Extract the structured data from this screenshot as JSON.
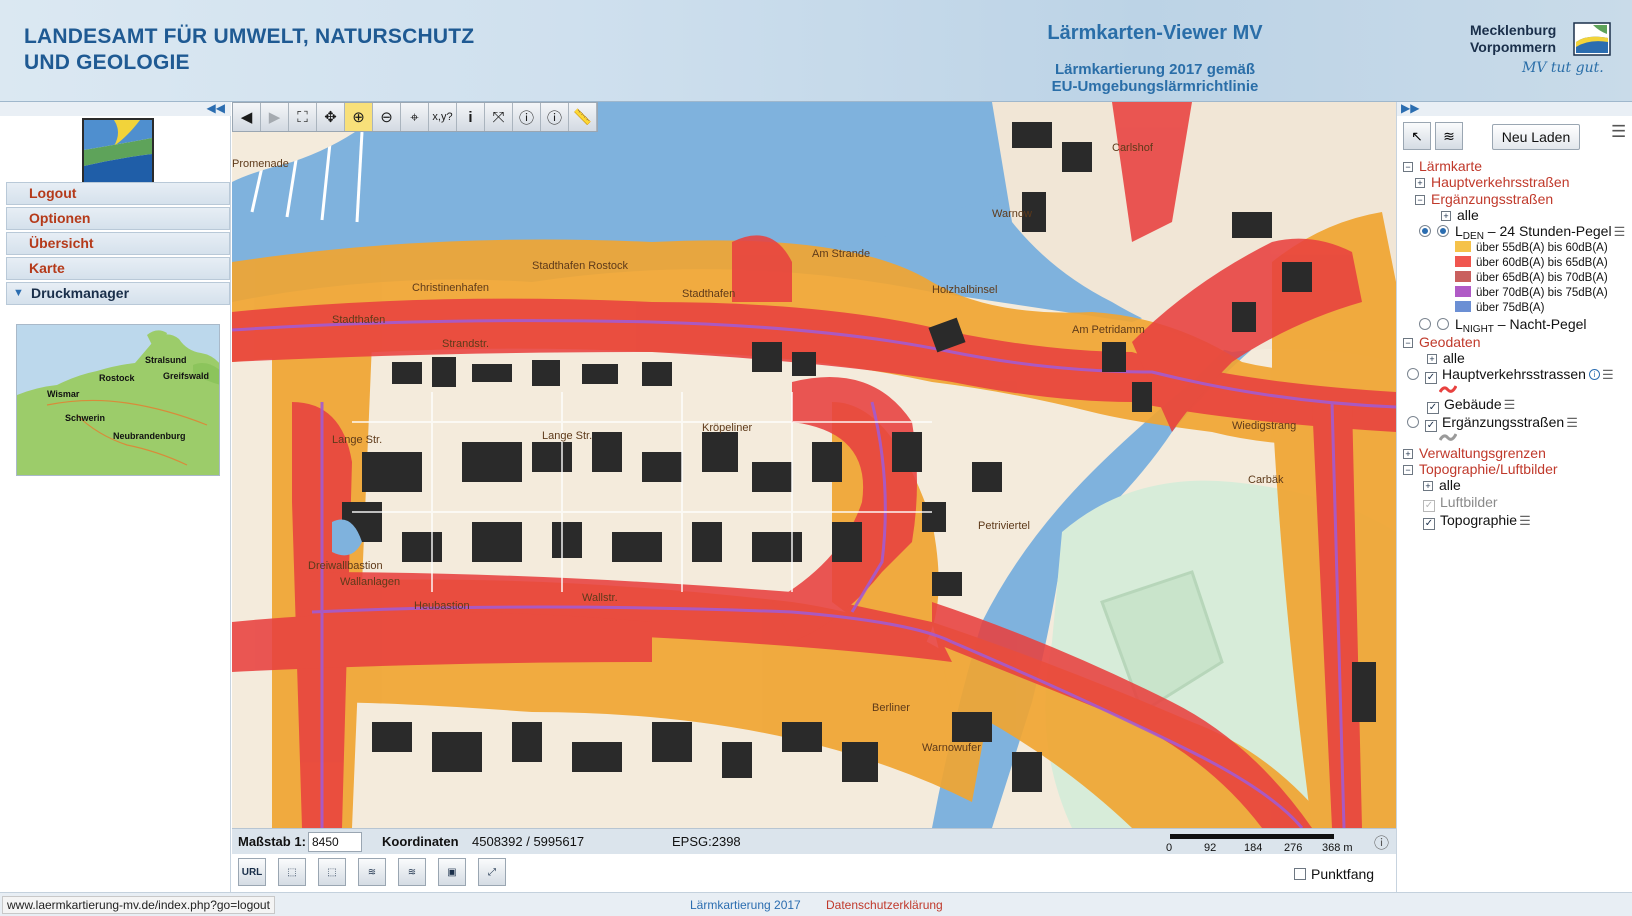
{
  "header": {
    "org_line1": "LANDESAMT FÜR UMWELT, NATURSCHUTZ",
    "org_line2": "UND GEOLOGIE",
    "viewer_title": "Lärmkarten-Viewer MV",
    "viewer_sub1": "Lärmkartierung 2017 gemäß",
    "viewer_sub2": "EU-Umgebungslärmrichtlinie",
    "logo_line1": "Mecklenburg",
    "logo_line2": "Vorpommern",
    "logo_slogan": "MV tut gut."
  },
  "left_menu": {
    "items": [
      "Logout",
      "Optionen",
      "Übersicht",
      "Karte"
    ],
    "active_item": "Druckmanager"
  },
  "overview_map": {
    "cities": [
      "Stralsund",
      "Rostock",
      "Greifswald",
      "Wismar",
      "Schwerin",
      "Neubrandenburg"
    ]
  },
  "map_labels": [
    "Promenade",
    "Stadthafen Rostock",
    "Christinenhafen",
    "Stadthafen",
    "Stadthafen",
    "Strandstr.",
    "Am Strande",
    "Lange Str.",
    "Lange Str.",
    "Wallstr.",
    "Wallanlagen",
    "Dreiwallbastion",
    "Am Petridamm",
    "Holzhalbinsel",
    "Petriviertel",
    "Wiedigstrang",
    "Carbäk",
    "Warnow",
    "Warnowufer",
    "Heubastion",
    "Kröpeliner",
    "Berliner",
    "Carlshof"
  ],
  "toolbar": {
    "tools": [
      "back-icon",
      "forward-icon",
      "zoom-full-icon",
      "pan-icon",
      "zoom-in-icon",
      "zoom-out-icon",
      "recenter-icon",
      "coordinates-icon",
      "info-icon",
      "zoom-extent-icon",
      "query-info-icon",
      "object-info-icon",
      "measure-icon"
    ],
    "coord_label": "x,y?",
    "info_label": "i"
  },
  "legend_panel": {
    "reload_label": "Neu Laden",
    "group_laermkarte": "Lärmkarte",
    "hauptverkehr": "Hauptverkehrsstraßen",
    "ergaenzung": "Ergänzungsstraßen",
    "alle": "alle",
    "lden_prefix": "L",
    "lden_sub": "DEN",
    "lden_suffix": " – 24 Stunden-Pegel",
    "lnight_prefix": "L",
    "lnight_sub": "NIGHT",
    "lnight_suffix": " – Nacht-Pegel",
    "classes": [
      {
        "label": "über 55dB(A) bis 60dB(A)",
        "color": "#f5c24a"
      },
      {
        "label": "über 60dB(A) bis 65dB(A)",
        "color": "#f0564f"
      },
      {
        "label": "über 65dB(A) bis 70dB(A)",
        "color": "#c9605e"
      },
      {
        "label": "über 70dB(A) bis 75dB(A)",
        "color": "#b05ac6"
      },
      {
        "label": "über 75dB(A)",
        "color": "#6b8fd4"
      }
    ],
    "group_geodaten": "Geodaten",
    "geo_alle": "alle",
    "geo_hauptverkehr": "Hauptverkehrsstrassen",
    "geo_gebaeude": "Gebäude",
    "geo_ergaenzung": "Ergänzungsstraßen",
    "group_verwaltung": "Verwaltungsgrenzen",
    "group_topo": "Topographie/Luftbilder",
    "topo_alle": "alle",
    "topo_luftbilder": "Luftbilder",
    "topo_topographie": "Topographie"
  },
  "statusbar": {
    "scale_label": "Maßstab 1:",
    "scale_value": "8450",
    "coord_label": "Koordinaten",
    "coord_value": "4508392 / 5995617",
    "epsg": "EPSG:2398",
    "scale_ticks": [
      "0",
      "92",
      "184",
      "276",
      "368 m"
    ]
  },
  "bottom_tools": {
    "url_label": "URL",
    "punktfang_label": "Punktfang"
  },
  "footer": {
    "url": "www.laermkartierung-mv.de/index.php?go=logout",
    "link1": "Lärmkartierung 2017",
    "link2": "Datenschutzerklärung"
  },
  "colors": {
    "header_blue": "#1f5a93",
    "menu_red": "#b53a1a",
    "water": "#7fb2dd",
    "noise_red": "#e8413f",
    "noise_orange": "#f0a532",
    "road_purple": "#a45bd0"
  }
}
